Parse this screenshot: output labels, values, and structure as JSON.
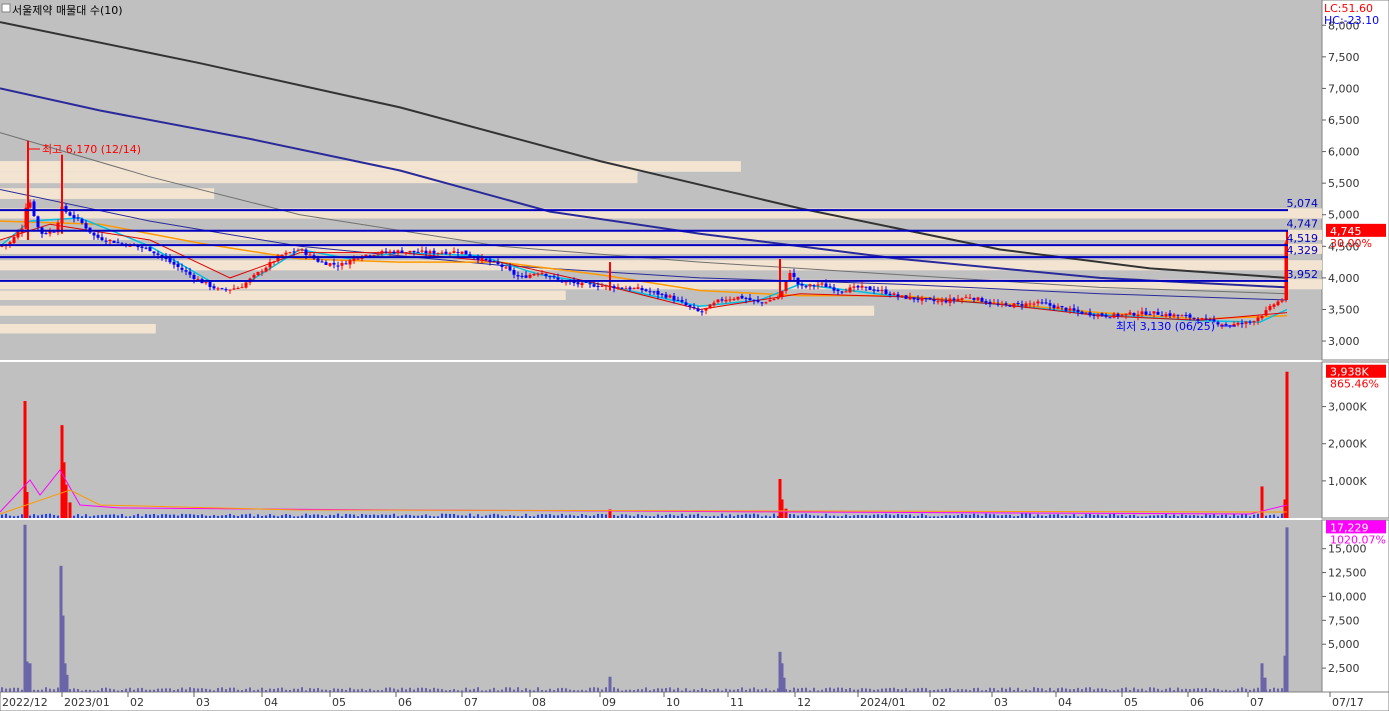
{
  "header": {
    "title": "서울제약 매물대 수(10)",
    "lc": "LC:51.60",
    "hc": "HC:-23.10"
  },
  "colors": {
    "bg": "#c0c0c0",
    "grid": "#d6d6d6",
    "up": "#ff0000",
    "down": "#0000ff",
    "ma_long": "#333333",
    "ma_navy": "#2a2a9a",
    "ma_orange": "#ff9900",
    "ma_cyan": "#00c0e0",
    "ma_red": "#e00000",
    "profile": "#f5e6d3",
    "hline": "#0000c0",
    "bar_purple": "#6a64a8",
    "magenta": "#ff00ff"
  },
  "chart_data": [
    {
      "type": "candlestick",
      "name_label": "서울제약 매물대 수(10)",
      "ylim": [
        2700,
        8400
      ],
      "yticks": [
        3000,
        3500,
        4000,
        4500,
        5000,
        5500,
        6000,
        6500,
        7000,
        7500,
        8000
      ],
      "ytick_labels": [
        "3,000",
        "3,500",
        "4,000",
        "4,500",
        "5,000",
        "5,500",
        "6,000",
        "6,500",
        "7,000",
        "7,500",
        "8,000"
      ],
      "xlabels": [
        "2022/12",
        "2023/01",
        "02",
        "03",
        "04",
        "05",
        "06",
        "07",
        "08",
        "09",
        "10",
        "11",
        "12",
        "2024/01",
        "02",
        "03",
        "04",
        "05",
        "06",
        "07",
        "07/17"
      ],
      "price_key": [
        [
          0,
          4500
        ],
        [
          10,
          4560
        ],
        [
          22,
          4800
        ],
        [
          28,
          5300
        ],
        [
          32,
          5100
        ],
        [
          40,
          4700
        ],
        [
          55,
          4750
        ],
        [
          62,
          5100
        ],
        [
          70,
          5000
        ],
        [
          80,
          4900
        ],
        [
          95,
          4650
        ],
        [
          120,
          4550
        ],
        [
          150,
          4450
        ],
        [
          180,
          4150
        ],
        [
          200,
          3950
        ],
        [
          220,
          3800
        ],
        [
          240,
          3850
        ],
        [
          260,
          4100
        ],
        [
          280,
          4350
        ],
        [
          300,
          4450
        ],
        [
          320,
          4250
        ],
        [
          340,
          4200
        ],
        [
          360,
          4350
        ],
        [
          380,
          4400
        ],
        [
          400,
          4420
        ],
        [
          430,
          4400
        ],
        [
          460,
          4420
        ],
        [
          480,
          4300
        ],
        [
          500,
          4200
        ],
        [
          520,
          4000
        ],
        [
          540,
          4100
        ],
        [
          560,
          3950
        ],
        [
          580,
          3900
        ],
        [
          600,
          3880
        ],
        [
          640,
          3820
        ],
        [
          670,
          3700
        ],
        [
          700,
          3450
        ],
        [
          720,
          3650
        ],
        [
          740,
          3700
        ],
        [
          760,
          3600
        ],
        [
          780,
          3700
        ],
        [
          790,
          4100
        ],
        [
          800,
          3850
        ],
        [
          820,
          3900
        ],
        [
          840,
          3800
        ],
        [
          860,
          3850
        ],
        [
          880,
          3800
        ],
        [
          900,
          3700
        ],
        [
          940,
          3620
        ],
        [
          970,
          3700
        ],
        [
          1000,
          3560
        ],
        [
          1040,
          3600
        ],
        [
          1080,
          3450
        ],
        [
          1110,
          3400
        ],
        [
          1150,
          3450
        ],
        [
          1190,
          3380
        ],
        [
          1230,
          3250
        ],
        [
          1250,
          3300
        ],
        [
          1265,
          3450
        ],
        [
          1275,
          3600
        ],
        [
          1282,
          3650
        ],
        [
          1287,
          4745
        ]
      ],
      "moving_averages": [
        {
          "name": "long",
          "points": [
            [
              0,
              8050
            ],
            [
              200,
              7400
            ],
            [
              400,
              6700
            ],
            [
              600,
              5850
            ],
            [
              800,
              5100
            ],
            [
              1000,
              4450
            ],
            [
              1150,
              4150
            ],
            [
              1287,
              4000
            ]
          ]
        },
        {
          "name": "navy",
          "points": [
            [
              0,
              7000
            ],
            [
              100,
              6650
            ],
            [
              250,
              6200
            ],
            [
              400,
              5700
            ],
            [
              550,
              5050
            ],
            [
              700,
              4700
            ],
            [
              900,
              4300
            ],
            [
              1100,
              4000
            ],
            [
              1287,
              3850
            ]
          ]
        },
        {
          "name": "navy_thin",
          "points": [
            [
              0,
              5400
            ],
            [
              150,
              4900
            ],
            [
              300,
              4500
            ],
            [
              500,
              4200
            ],
            [
              700,
              4000
            ],
            [
              900,
              3900
            ],
            [
              1100,
              3750
            ],
            [
              1287,
              3650
            ]
          ]
        },
        {
          "name": "grey_thin",
          "points": [
            [
              0,
              6300
            ],
            [
              150,
              5600
            ],
            [
              300,
              5000
            ],
            [
              500,
              4500
            ],
            [
              700,
              4250
            ],
            [
              900,
              4050
            ],
            [
              1100,
              3850
            ],
            [
              1287,
              3750
            ]
          ]
        },
        {
          "name": "orange",
          "points": [
            [
              0,
              4900
            ],
            [
              100,
              4850
            ],
            [
              200,
              4550
            ],
            [
              300,
              4300
            ],
            [
              400,
              4250
            ],
            [
              500,
              4250
            ],
            [
              600,
              4050
            ],
            [
              700,
              3800
            ],
            [
              800,
              3720
            ],
            [
              900,
              3720
            ],
            [
              1000,
              3600
            ],
            [
              1100,
              3450
            ],
            [
              1200,
              3350
            ],
            [
              1287,
              3400
            ]
          ]
        },
        {
          "name": "cyan",
          "points": [
            [
              0,
              4500
            ],
            [
              30,
              4900
            ],
            [
              80,
              4950
            ],
            [
              150,
              4500
            ],
            [
              210,
              3950
            ],
            [
              250,
              3950
            ],
            [
              300,
              4450
            ],
            [
              350,
              4300
            ],
            [
              400,
              4400
            ],
            [
              480,
              4350
            ],
            [
              540,
              4050
            ],
            [
              600,
              3900
            ],
            [
              700,
              3550
            ],
            [
              760,
              3650
            ],
            [
              800,
              3900
            ],
            [
              900,
              3700
            ],
            [
              1000,
              3580
            ],
            [
              1100,
              3420
            ],
            [
              1200,
              3320
            ],
            [
              1260,
              3300
            ],
            [
              1287,
              3500
            ]
          ]
        },
        {
          "name": "red",
          "points": [
            [
              0,
              4600
            ],
            [
              50,
              4850
            ],
            [
              150,
              4600
            ],
            [
              230,
              4000
            ],
            [
              300,
              4400
            ],
            [
              400,
              4400
            ],
            [
              500,
              4250
            ],
            [
              600,
              3900
            ],
            [
              700,
              3500
            ],
            [
              800,
              3750
            ],
            [
              900,
              3700
            ],
            [
              1000,
              3580
            ],
            [
              1100,
              3400
            ],
            [
              1200,
              3330
            ],
            [
              1287,
              3450
            ]
          ]
        }
      ],
      "volume_profile": [
        {
          "price_lo": 5680,
          "price_hi": 5850,
          "volume": 723
        },
        {
          "price_lo": 5500,
          "price_hi": 5680,
          "volume": 622
        },
        {
          "price_lo": 5250,
          "price_hi": 5420,
          "volume": 209
        },
        {
          "price_lo": 4940,
          "price_hi": 5100,
          "volume": 1290
        },
        {
          "price_lo": 4600,
          "price_hi": 4760,
          "volume": 1290
        },
        {
          "price_lo": 4380,
          "price_hi": 4540,
          "volume": 1290
        },
        {
          "price_lo": 4120,
          "price_hi": 4280,
          "volume": 1290
        },
        {
          "price_lo": 3820,
          "price_hi": 3980,
          "volume": 1290
        },
        {
          "price_lo": 3650,
          "price_hi": 3800,
          "volume": 552
        },
        {
          "price_lo": 3400,
          "price_hi": 3560,
          "volume": 853
        },
        {
          "price_lo": 3120,
          "price_hi": 3270,
          "volume": 152
        }
      ],
      "horizontal_lines": [
        {
          "value": 5074,
          "label": "5,074"
        },
        {
          "value": 4747,
          "label": "4,747"
        },
        {
          "value": 4519,
          "label": "4,519"
        },
        {
          "value": 4329,
          "label": "4,329"
        },
        {
          "value": 3952,
          "label": "3,952"
        }
      ],
      "annotations": {
        "high": "최고 6,170 (12/14)",
        "low": "최저 3,130 (06/25)",
        "last_price": "4,745",
        "change_pct": "30.00%"
      }
    },
    {
      "type": "bar",
      "name_label": "volume",
      "ylim": [
        0,
        4200
      ],
      "yticks": [
        1000,
        2000,
        3000
      ],
      "ytick_labels": [
        "1,000K",
        "2,000K",
        "3,000K"
      ],
      "spikes": [
        [
          25,
          3150
        ],
        [
          27,
          700
        ],
        [
          62,
          2500
        ],
        [
          64,
          1500
        ],
        [
          66,
          900
        ],
        [
          70,
          420
        ],
        [
          610,
          230
        ],
        [
          780,
          1050
        ],
        [
          782,
          500
        ],
        [
          786,
          250
        ],
        [
          1262,
          850
        ],
        [
          1285,
          500
        ],
        [
          1287,
          3938
        ]
      ],
      "last_value": "3,938K",
      "change_pct": "865.46%"
    },
    {
      "type": "bar",
      "name_label": "turnover",
      "ylim": [
        0,
        18000
      ],
      "yticks": [
        2500,
        5000,
        7500,
        10000,
        12500,
        15000
      ],
      "ytick_labels": [
        "2,500",
        "5,000",
        "7,500",
        "10,000",
        "12,500",
        "15,000"
      ],
      "spikes": [
        [
          25,
          17500
        ],
        [
          27,
          3200
        ],
        [
          30,
          3000
        ],
        [
          61,
          13200
        ],
        [
          63,
          8000
        ],
        [
          65,
          3000
        ],
        [
          67,
          1800
        ],
        [
          610,
          1600
        ],
        [
          780,
          4200
        ],
        [
          782,
          3000
        ],
        [
          784,
          1500
        ],
        [
          1262,
          3000
        ],
        [
          1265,
          1500
        ],
        [
          1285,
          3800
        ],
        [
          1287,
          17229
        ]
      ],
      "last_value": "17,229",
      "change_pct": "1020.07%"
    }
  ]
}
